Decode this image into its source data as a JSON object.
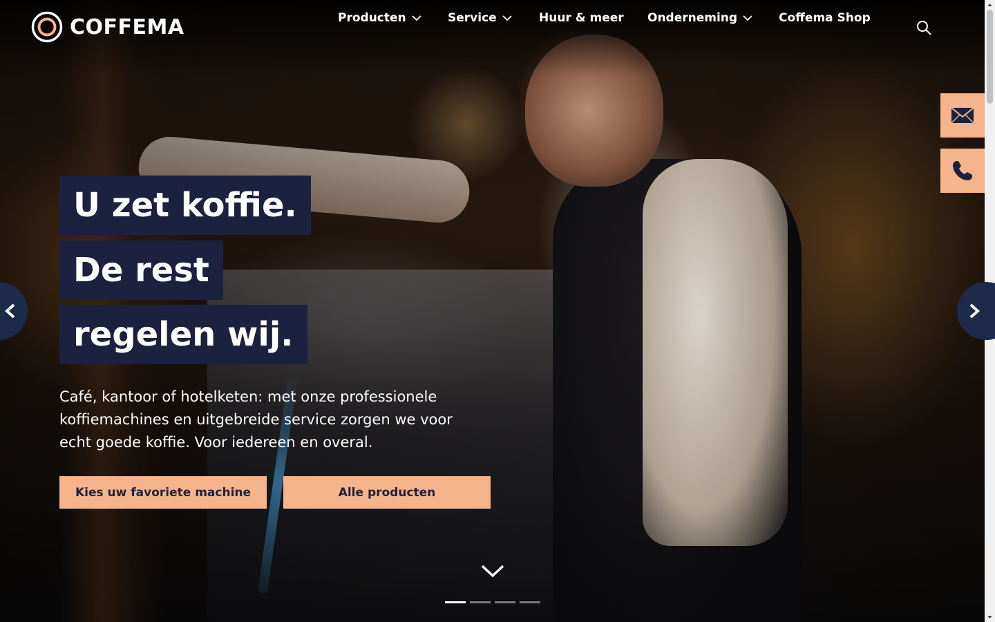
{
  "brand": {
    "name": "COFFEMA",
    "accent": "#f5b48c",
    "navy": "#1c2140"
  },
  "nav": {
    "items": [
      {
        "label": "Producten",
        "dropdown": true
      },
      {
        "label": "Service",
        "dropdown": true
      },
      {
        "label": "Huur & meer",
        "dropdown": false
      },
      {
        "label": "Onderneming",
        "dropdown": true
      },
      {
        "label": "Coffema Shop",
        "dropdown": false
      }
    ],
    "search_icon": "search-icon"
  },
  "hero": {
    "headline_lines": [
      "U zet koffie.",
      "De rest",
      "regelen wij."
    ],
    "intro": "Café, kantoor of hotelketen: met onze professionele koffiemachines en uitgebreide service zorgen we voor echt goede koffie. Voor iedereen en overal.",
    "cta_primary": "Kies uw favoriete machine",
    "cta_secondary": "Alle producten",
    "slides": {
      "count": 4,
      "active": 1
    }
  },
  "side_buttons": [
    {
      "icon": "mail-icon"
    },
    {
      "icon": "phone-icon"
    }
  ]
}
